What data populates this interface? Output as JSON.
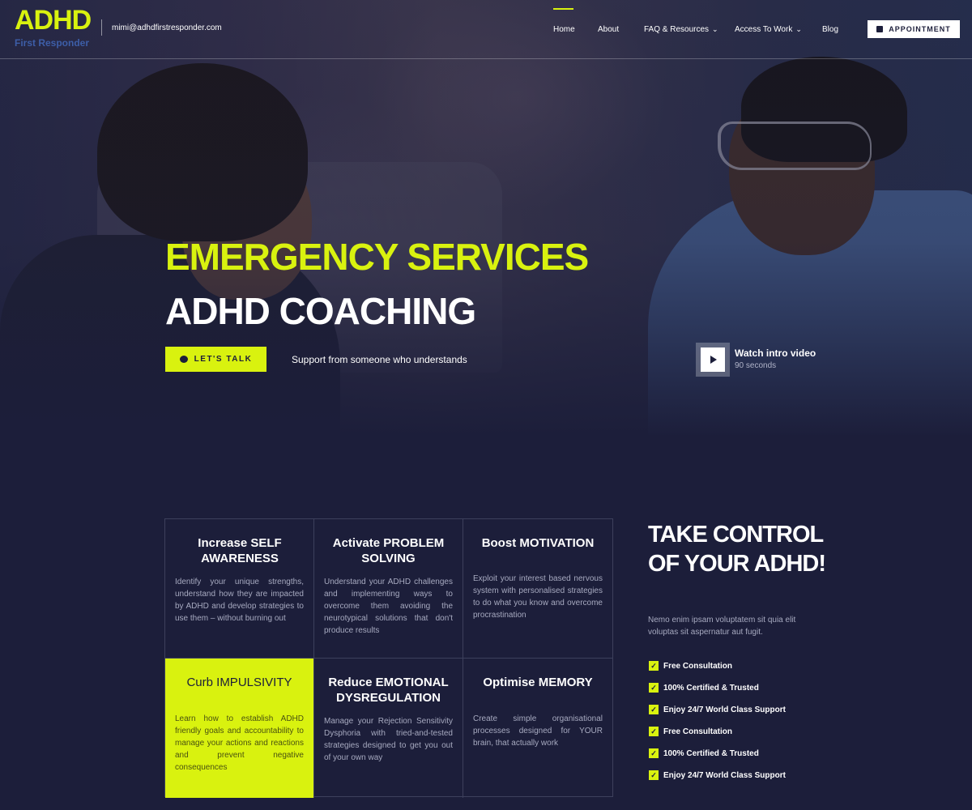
{
  "header": {
    "logo_text": "ADHD",
    "logo_subtext": "First Responder",
    "email": "mimi@adhdfirstresponder.com",
    "nav": [
      {
        "label": "Home",
        "active": true,
        "dropdown": false
      },
      {
        "label": "About",
        "active": false,
        "dropdown": false
      },
      {
        "label": "FAQ & Resources",
        "active": false,
        "dropdown": true
      },
      {
        "label": "Access To Work",
        "active": false,
        "dropdown": true
      },
      {
        "label": "Blog",
        "active": false,
        "dropdown": false
      }
    ],
    "appointment_label": "APPOINTMENT",
    "appointment_icon": "calendar-icon"
  },
  "hero": {
    "title_line1": "EMERGENCY SERVICES",
    "title_line2": "ADHD COACHING",
    "cta_label": "LET'S TALK",
    "cta_icon": "chat-bubble-icon",
    "support_text": "Support from someone who understands",
    "video_label": "Watch intro video",
    "video_duration": "90 seconds"
  },
  "features": [
    {
      "title": "Increase SELF AWARENESS",
      "text": "Identify your unique strengths, understand how they are impacted by ADHD and develop strategies to use them – without burning out",
      "highlight": false
    },
    {
      "title": "Activate PROBLEM SOLVING",
      "text": "Understand your ADHD challenges and implementing ways to overcome them avoiding the neurotypical solutions that don't produce results",
      "highlight": false
    },
    {
      "title": "Boost MOTIVATION",
      "text": "Exploit your interest based nervous system with personalised strategies to do what you know and overcome procrastination",
      "highlight": false
    },
    {
      "title": "Curb IMPULSIVITY",
      "text": "Learn how to establish ADHD friendly goals and accountability to manage your actions and reactions and prevent negative consequences",
      "highlight": true
    },
    {
      "title": "Reduce EMOTIONAL DYSREGULATION",
      "text": "Manage your Rejection Sensitivity Dysphoria with tried-and-tested strategies designed to get you out of your own way",
      "highlight": false
    },
    {
      "title": "Optimise MEMORY",
      "text": "Create simple organisational processes designed for YOUR brain, that actually work",
      "highlight": false
    }
  ],
  "take_control": {
    "title": "TAKE CONTROL OF YOUR ADHD!",
    "text": "Nemo enim ipsam voluptatem sit quia elit voluptas sit aspernatur aut fugit.",
    "checklist": [
      "Free Consultation",
      "100% Certified & Trusted",
      "Enjoy 24/7 World Class Support",
      "Free Consultation",
      "100% Certified & Trusted",
      "Enjoy 24/7 World Class Support"
    ]
  },
  "colors": {
    "accent": "#d9f20f",
    "background": "#1c1e3a",
    "muted_text": "#a7aac0"
  }
}
